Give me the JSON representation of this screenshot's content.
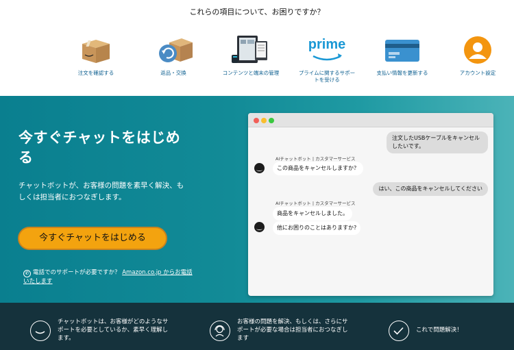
{
  "topics": {
    "title": "これらの項目について、お困りですか？",
    "items": [
      {
        "label": "注文を確認する",
        "icon": "package-icon"
      },
      {
        "label": "返品・交換",
        "icon": "return-box-icon"
      },
      {
        "label": "コンテンツと端末の管理",
        "icon": "devices-icon"
      },
      {
        "label": "プライムに関するサポートを受ける",
        "icon": "prime-icon",
        "logo_text": "prime"
      },
      {
        "label": "支払い情報を更新する",
        "icon": "credit-card-icon"
      },
      {
        "label": "アカウント設定",
        "icon": "account-icon"
      }
    ]
  },
  "hero": {
    "title": "今すぐチャットをはじめる",
    "description": "チャットボットが、お客様の問題を素早く解決、もしくは担当者におつなぎします。",
    "cta_label": "今すぐチャットをはじめる",
    "phone_text": "電話でのサポートが必要ですか？",
    "phone_link": "Amazon.co.jp からお電話いたします"
  },
  "chat": {
    "messages": [
      {
        "from": "user",
        "text": "注文したUSBケーブルをキャンセルしたいです。"
      },
      {
        "from": "bot",
        "label": "AIチャットボット | カスタマーサービス",
        "text": "この商品をキャンセルしますか？"
      },
      {
        "from": "user",
        "text": "はい、この商品をキャンセルしてください"
      },
      {
        "from": "bot",
        "label": "AIチャットボット | カスタマーサービス",
        "text": "商品をキャンセルしました。"
      },
      {
        "from": "bot",
        "label": "",
        "text": "他にお困りのことはありますか?"
      }
    ]
  },
  "features": [
    {
      "text": "チャットボットは、お客様がどのようなサポートを必要としているか、素早く理解します。",
      "icon": "chatbot-icon"
    },
    {
      "text": "お客様の問題を解決、もしくは、さらにサポートが必要な場合は担当者におつなぎします",
      "icon": "headset-agent-icon"
    },
    {
      "text": "これで問題解決！",
      "icon": "checkmark-icon"
    }
  ],
  "colors": {
    "accent": "#f3a30f",
    "hero_bg": "#128b97",
    "footer_bg": "#15323c",
    "link": "#0b5e8f",
    "prime_blue": "#1a98d5"
  }
}
